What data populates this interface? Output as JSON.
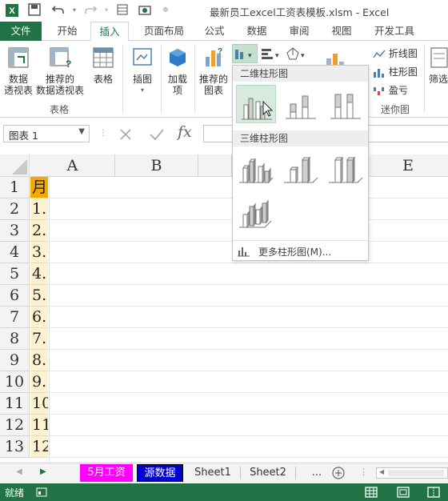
{
  "titlebar": {
    "title": "最新员工excel工资表模板.xlsm - Excel"
  },
  "tabs": [
    "文件",
    "开始",
    "插入",
    "页面布局",
    "公式",
    "数据",
    "审阅",
    "视图",
    "开发工具"
  ],
  "ribbon": {
    "pivot_table": "数据\n透视表",
    "recommended_pivot": "推荐的\n数据透视表",
    "table": "表格",
    "group_tables": "表格",
    "illustrations": "插图",
    "addins": "加载\n项",
    "recommended_charts": "推荐的\n图表",
    "sparklines": {
      "line": "折线图",
      "column": "柱形图",
      "winloss": "盈亏",
      "group": "迷你图"
    },
    "filter": "筛选"
  },
  "formula_bar": {
    "namebox": "图表 1",
    "fx": "fx"
  },
  "columns": [
    "A",
    "B",
    "E"
  ],
  "rows": [
    "1",
    "2",
    "3",
    "4",
    "5",
    "6",
    "7",
    "8",
    "9",
    "10",
    "11",
    "12",
    "13"
  ],
  "col_a_values": [
    "月",
    "1.",
    "2.",
    "3.",
    "4.",
    "5.",
    "6.",
    "7.",
    "8.",
    "9.",
    "10",
    "11",
    "12"
  ],
  "sheets": {
    "tab1": "5月工资",
    "tab2": "源数据",
    "tab3": "Sheet1",
    "tab4": "Sheet2",
    "more": "..."
  },
  "status": {
    "ready": "就绪"
  },
  "dropdown": {
    "section_2d": "二维柱形图",
    "section_3d": "三维柱形图",
    "more_link": "更多柱形图(M)..."
  },
  "colors": {
    "excel_green": "#217346",
    "tab1_bg": "#ff00ff",
    "tab2_bg": "#0000cc",
    "cell_fill": "#fdf2d0",
    "header_cell_fill": "#f5a800"
  }
}
